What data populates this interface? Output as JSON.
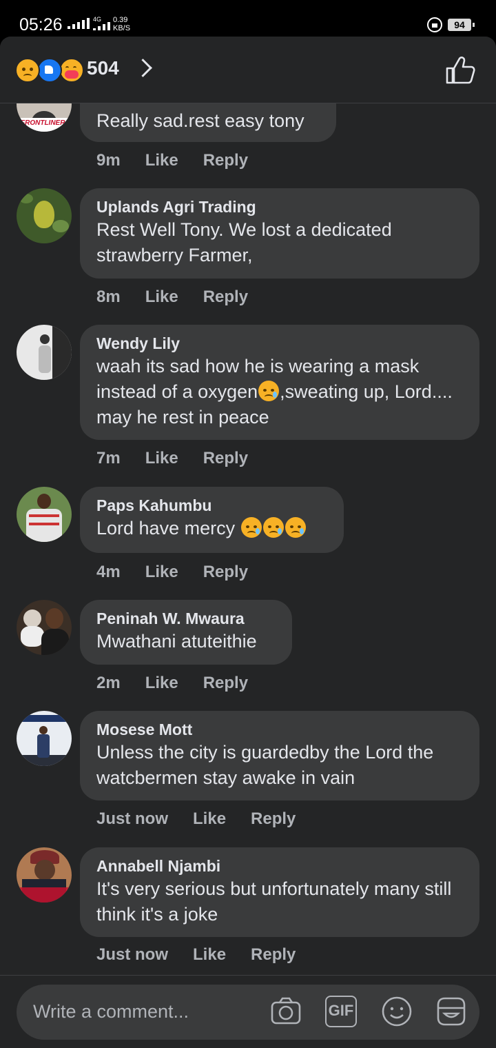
{
  "status_bar": {
    "time": "05:26",
    "network": "4G",
    "speed_value": "0.39",
    "speed_unit": "KB/S",
    "battery": "94"
  },
  "reactions": {
    "count": "504",
    "icons": [
      "sad-emoji-icon",
      "like-reaction-icon",
      "care-emoji-icon"
    ]
  },
  "comments": [
    {
      "name": "",
      "text": "Really sad.rest easy tony",
      "time": "9m",
      "like": "Like",
      "reply": "Reply",
      "avatar_label": "FRONTLINER"
    },
    {
      "name": "Uplands Agri Trading",
      "text": "Rest Well Tony. We lost a dedicated strawberry Farmer,",
      "time": "8m",
      "like": "Like",
      "reply": "Reply"
    },
    {
      "name": "Wendy Lily",
      "text_a": "waah its sad how he is wearing a mask instead of a oxygen",
      "text_b": ",sweating up, Lord.... may he rest in peace",
      "time": "7m",
      "like": "Like",
      "reply": "Reply"
    },
    {
      "name": "Paps Kahumbu",
      "text": "Lord have mercy ",
      "time": "4m",
      "like": "Like",
      "reply": "Reply"
    },
    {
      "name": "Peninah W. Mwaura",
      "text": "Mwathani atuteithie",
      "time": "2m",
      "like": "Like",
      "reply": "Reply"
    },
    {
      "name": "Mosese Mott",
      "text": "Unless the city is guardedby the Lord the watcbermen stay awake in vain",
      "time": "Just now",
      "like": "Like",
      "reply": "Reply"
    },
    {
      "name": "Annabell Njambi",
      "text": "It's very serious but unfortunately many still think it's a joke",
      "time": "Just now",
      "like": "Like",
      "reply": "Reply"
    }
  ],
  "composer": {
    "placeholder": "Write a comment...",
    "gif_label": "GIF"
  },
  "colors": {
    "background": "#242526",
    "bubble": "#3a3b3c",
    "text": "#e4e6eb",
    "meta": "#b0b3b8"
  }
}
